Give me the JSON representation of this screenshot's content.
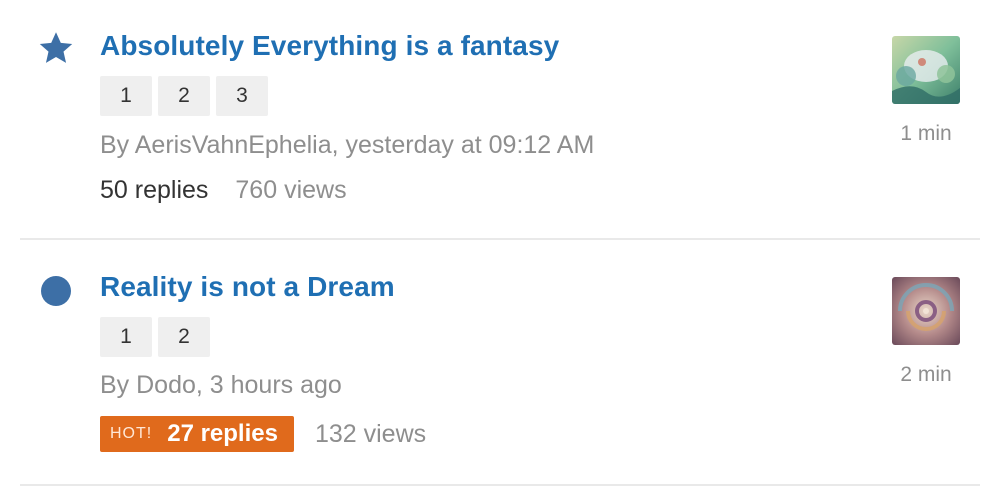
{
  "topics": [
    {
      "status_icon": "star-icon",
      "title": "Absolutely Everything is a fantasy",
      "pages": [
        "1",
        "2",
        "3"
      ],
      "meta": "By AerisVahnEphelia, yesterday at 09:12 AM",
      "replies": "50 replies",
      "views": "760 views",
      "hot": false,
      "last_post_time": "1 min"
    },
    {
      "status_icon": "circle-icon",
      "title": "Reality is not a Dream",
      "pages": [
        "1",
        "2"
      ],
      "meta": "By Dodo, 3 hours ago",
      "hot_label": "HOT!",
      "replies": "27 replies",
      "views": "132 views",
      "hot": true,
      "last_post_time": "2 min"
    }
  ],
  "colors": {
    "link": "#1f6fb3",
    "icon": "#3d6fa6",
    "hot": "#e06a1c"
  }
}
